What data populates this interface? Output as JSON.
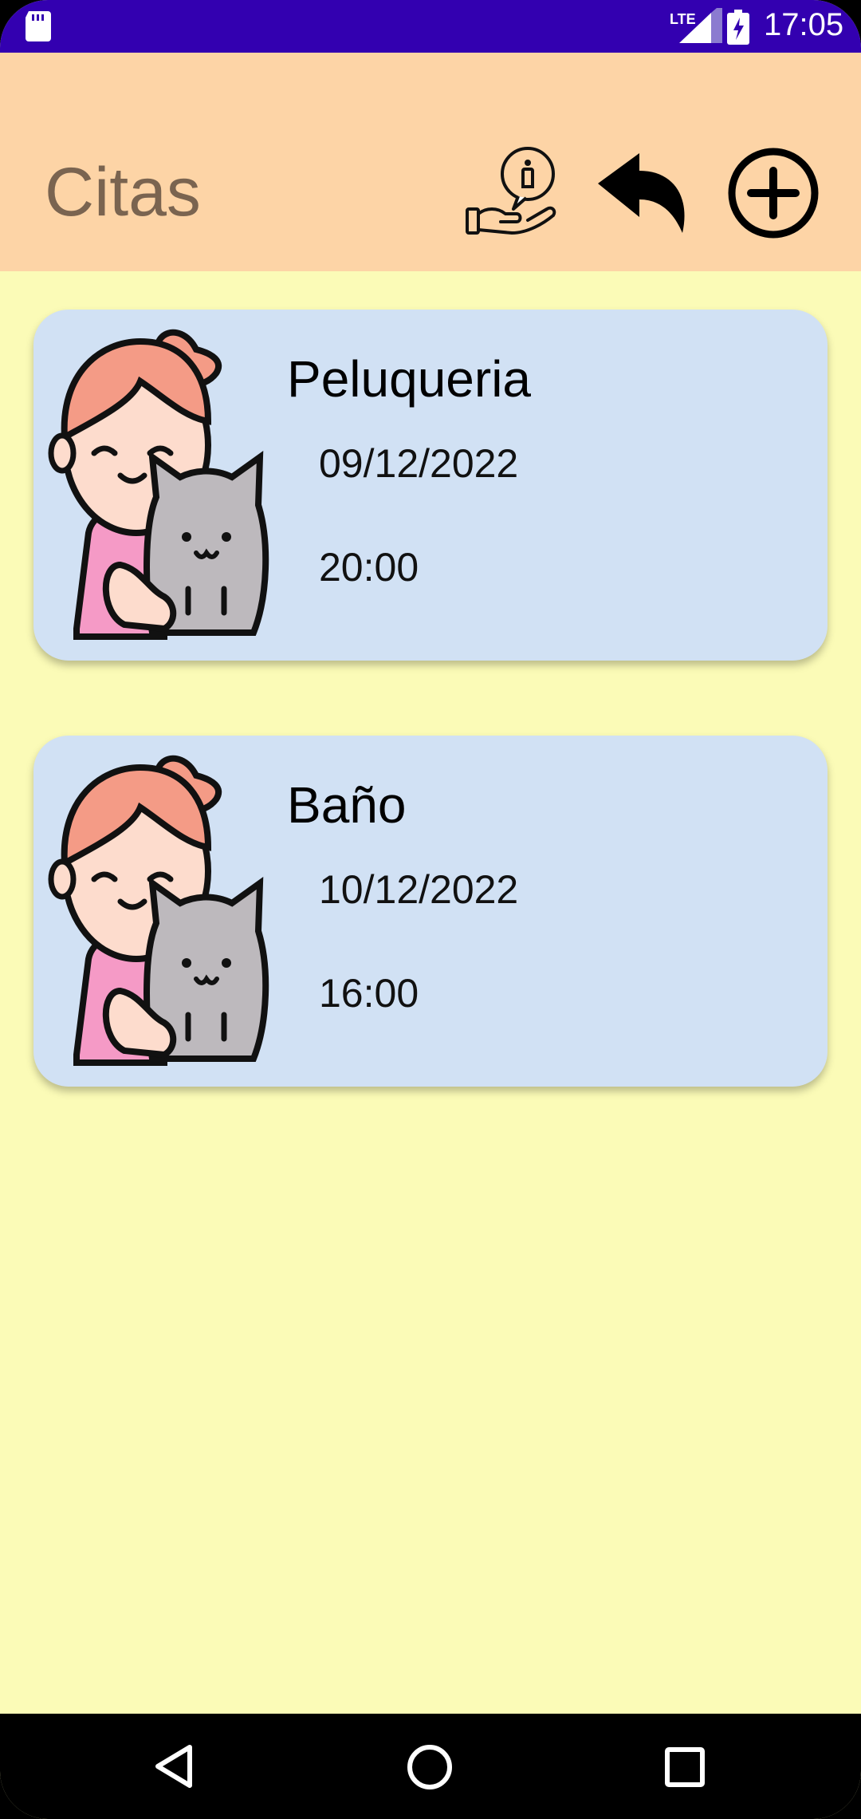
{
  "status_bar": {
    "clock": "17:05",
    "network": "LTE",
    "icons": [
      "sd-card-icon",
      "lte-signal-icon",
      "battery-charging-icon"
    ]
  },
  "app_bar": {
    "title": "Citas",
    "actions": [
      "info-hand-icon",
      "back-arrow-icon",
      "add-circle-icon"
    ]
  },
  "appointments": [
    {
      "title": "Peluqueria",
      "date": "09/12/2022",
      "time": "20:00",
      "avatar": "girl-with-cat-icon"
    },
    {
      "title": "Baño",
      "date": "10/12/2022",
      "time": "16:00",
      "avatar": "girl-with-cat-icon"
    }
  ],
  "nav_bar": {
    "buttons": [
      "nav-back-icon",
      "nav-home-icon",
      "nav-recents-icon"
    ]
  },
  "colors": {
    "status_bar": "#3300B0",
    "app_bar": "#FDD4A6",
    "background": "#FBFBB7",
    "card": "#D1E1F4",
    "title_text": "#7A6450"
  }
}
